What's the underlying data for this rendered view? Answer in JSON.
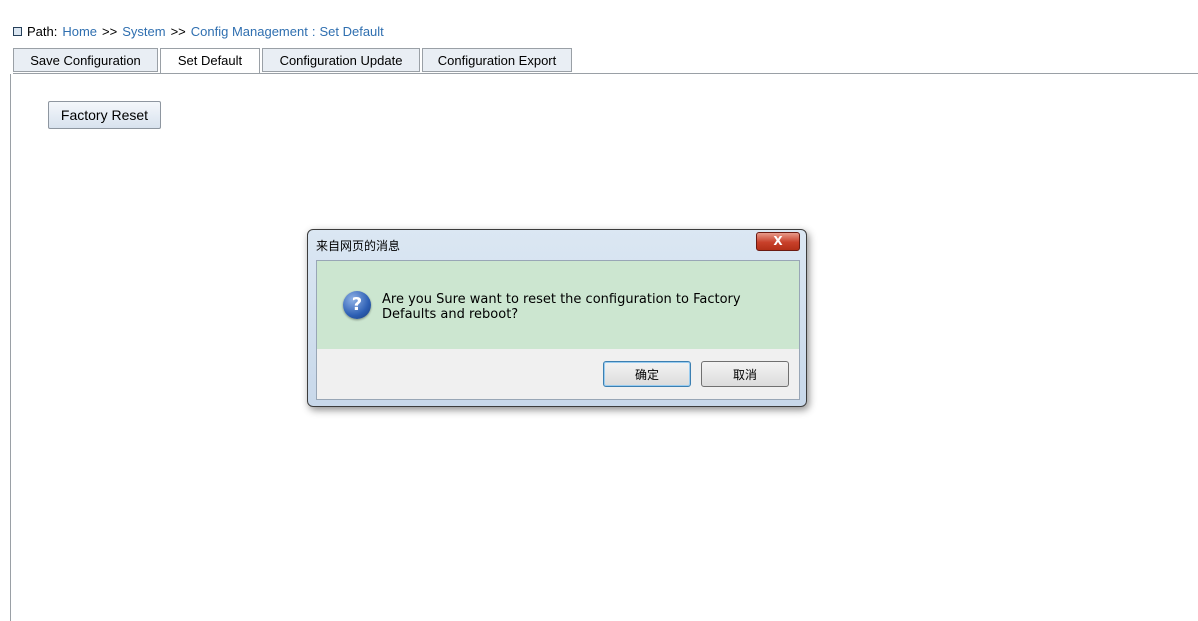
{
  "path": {
    "label": "Path:",
    "crumbs": [
      "Home",
      "System",
      "Config Management",
      "Set Default"
    ],
    "separator": ">>",
    "final_separator": ":"
  },
  "tabs": [
    {
      "label": "Save Configuration",
      "active": false
    },
    {
      "label": "Set Default",
      "active": true
    },
    {
      "label": "Configuration Update",
      "active": false
    },
    {
      "label": "Configuration Export",
      "active": false
    }
  ],
  "main": {
    "factory_reset_label": "Factory Reset"
  },
  "dialog": {
    "title": "来自网页的消息",
    "close_label": "X",
    "icon": "question-icon",
    "message": "Are you Sure want to reset the configuration to Factory Defaults and reboot?",
    "ok_label": "确定",
    "cancel_label": "取消"
  },
  "colors": {
    "link": "#2f6fb0",
    "dialog_message_bg": "#cce6d0",
    "close_button": "#c8402a"
  }
}
